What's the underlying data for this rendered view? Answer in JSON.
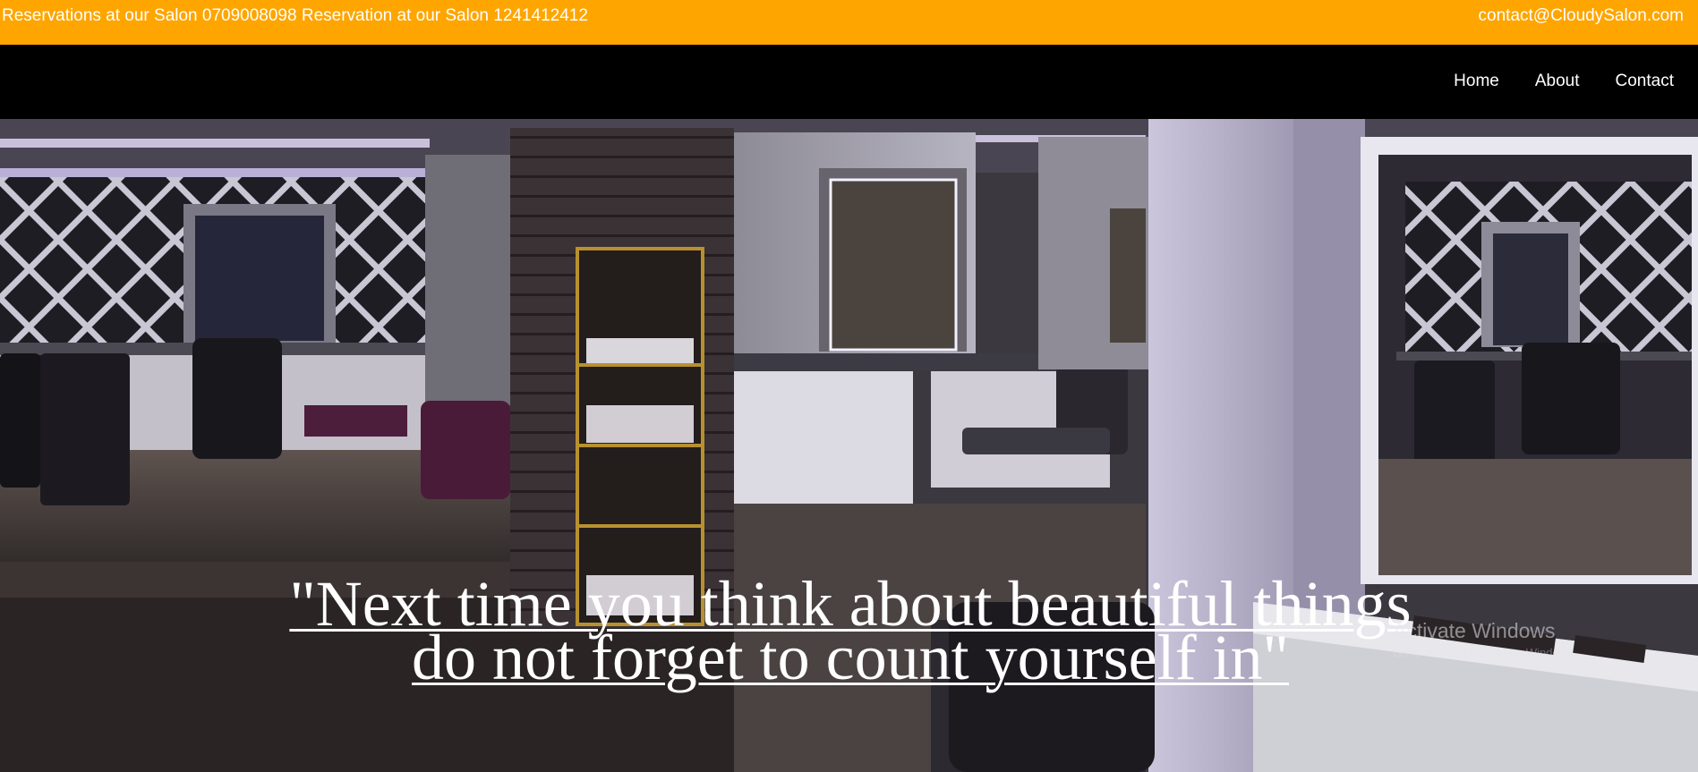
{
  "topbar": {
    "reservations_text": "Reservations at our Salon 0709008098 Reservation at our Salon 1241412412",
    "contact_email": "contact@CloudySalon.com"
  },
  "nav": {
    "items": [
      {
        "label": "Home"
      },
      {
        "label": "About"
      },
      {
        "label": "Contact"
      }
    ]
  },
  "hero": {
    "quote_line1": "\"Next time you think about beautiful things",
    "quote_line2": "do not forget to count yourself in\""
  },
  "watermark": {
    "title": "Activate Windows",
    "subtitle": "Go to Settings to activate Windows."
  },
  "colors": {
    "topbar": "#ffa500",
    "navbar": "#000000",
    "text": "#ffffff"
  }
}
